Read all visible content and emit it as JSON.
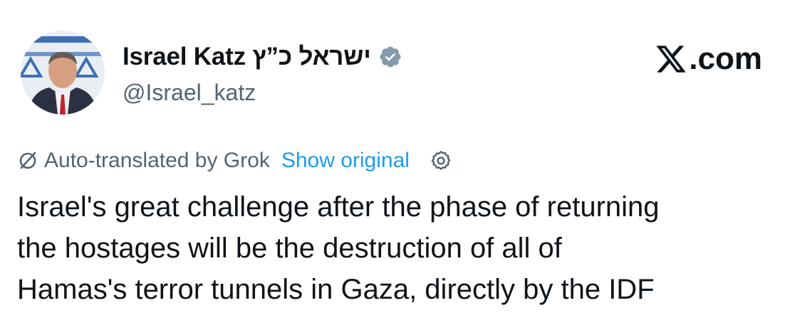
{
  "author": {
    "display_name": "Israel Katz ישראל כ”ץ",
    "handle": "@Israel_katz",
    "verified": true,
    "verified_color": "#829aab",
    "avatar_icon": "profile-photo"
  },
  "brand": {
    "icon": "x-logo-icon",
    "label": ".com"
  },
  "translation": {
    "icon": "translate-slash-icon",
    "label": "Auto-translated by Grok",
    "show_original_label": "Show original",
    "link_color": "#1d9bf0",
    "settings_icon": "gear-icon"
  },
  "tweet": {
    "lines": [
      "Israel's great challenge after the phase of returning",
      "the hostages will be the destruction of all of",
      "Hamas's terror tunnels in Gaza, directly by the IDF"
    ]
  },
  "colors": {
    "text": "#0f1419",
    "secondary": "#536471",
    "background": "#ffffff"
  }
}
